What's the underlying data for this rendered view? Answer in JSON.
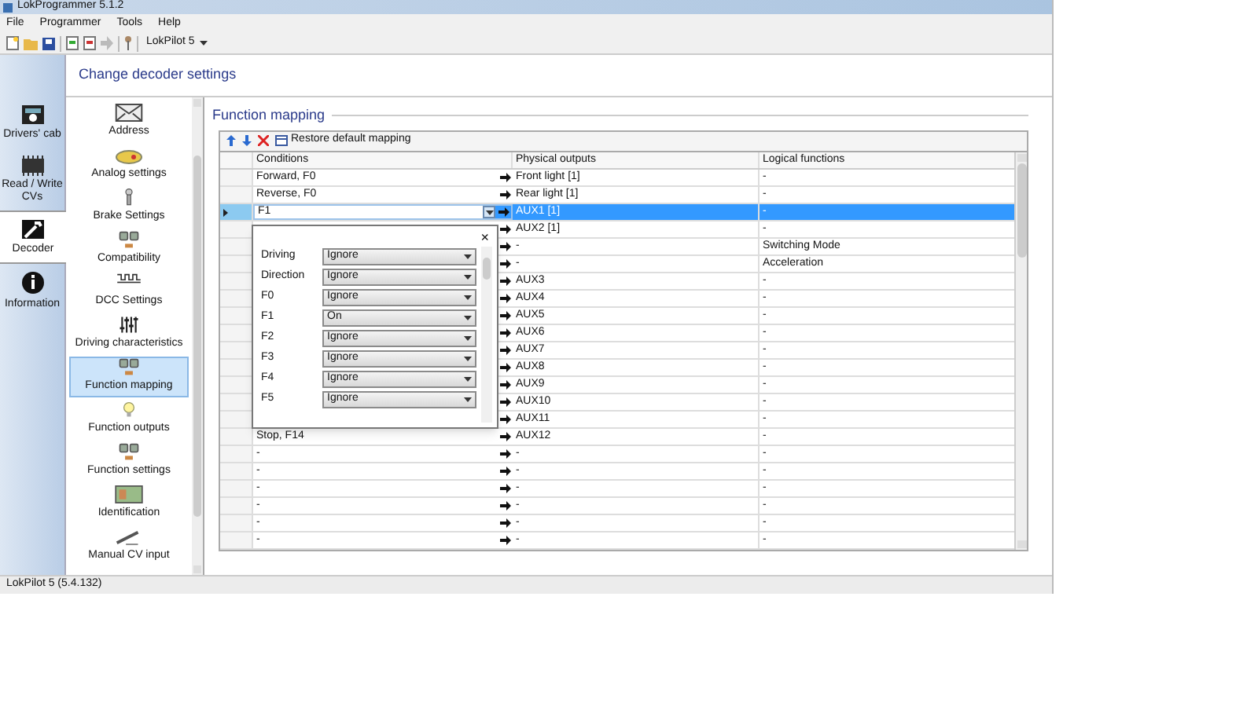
{
  "window": {
    "title": "LokProgrammer 5.1.2"
  },
  "menu": [
    "File",
    "Programmer",
    "Tools",
    "Help"
  ],
  "toolbar": {
    "device": "LokPilot 5"
  },
  "side_tabs": [
    {
      "label": "Drivers' cab",
      "selected": false
    },
    {
      "label": "Read / Write CVs",
      "selected": false
    },
    {
      "label": "Decoder",
      "selected": true
    },
    {
      "label": "Information",
      "selected": false
    }
  ],
  "page_title": "Change decoder settings",
  "categories": [
    {
      "label": "Address",
      "selected": false
    },
    {
      "label": "Analog settings",
      "selected": false
    },
    {
      "label": "Brake Settings",
      "selected": false
    },
    {
      "label": "Compatibility",
      "selected": false
    },
    {
      "label": "DCC Settings",
      "selected": false
    },
    {
      "label": "Driving characteristics",
      "selected": false
    },
    {
      "label": "Function mapping",
      "selected": true
    },
    {
      "label": "Function outputs",
      "selected": false
    },
    {
      "label": "Function settings",
      "selected": false
    },
    {
      "label": "Identification",
      "selected": false
    },
    {
      "label": "Manual CV input",
      "selected": false
    }
  ],
  "section_title": "Function mapping",
  "table_toolbar": {
    "restore_button": "Restore default mapping"
  },
  "table": {
    "columns": [
      "Conditions",
      "Physical outputs",
      "Logical functions"
    ],
    "rows": [
      {
        "condition": "Forward, F0",
        "output": "Front light [1]",
        "logic": "-",
        "selected": false
      },
      {
        "condition": "Reverse, F0",
        "output": "Rear light [1]",
        "logic": "-",
        "selected": false
      },
      {
        "condition": "F1",
        "output": "AUX1 [1]",
        "logic": "-",
        "selected": true
      },
      {
        "output": "AUX2 [1]",
        "logic": "-",
        "selected": false
      },
      {
        "output": "-",
        "logic": "Switching Mode",
        "selected": false
      },
      {
        "output": "-",
        "logic": "Acceleration",
        "selected": false
      },
      {
        "output": "AUX3",
        "logic": "-",
        "selected": false
      },
      {
        "output": "AUX4",
        "logic": "-",
        "selected": false
      },
      {
        "output": "AUX5",
        "logic": "-",
        "selected": false
      },
      {
        "output": "AUX6",
        "logic": "-",
        "selected": false
      },
      {
        "output": "AUX7",
        "logic": "-",
        "selected": false
      },
      {
        "output": "AUX8",
        "logic": "-",
        "selected": false
      },
      {
        "output": "AUX9",
        "logic": "-",
        "selected": false
      },
      {
        "output": "AUX10",
        "logic": "-",
        "selected": false
      },
      {
        "output": "AUX11",
        "logic": "-",
        "selected": false
      },
      {
        "condition": "Stop, F14",
        "output": "AUX12",
        "logic": "-",
        "selected": false
      },
      {
        "condition": "-",
        "output": "-",
        "logic": "-",
        "selected": false
      },
      {
        "condition": "-",
        "output": "-",
        "logic": "-",
        "selected": false
      },
      {
        "condition": "-",
        "output": "-",
        "logic": "-",
        "selected": false
      },
      {
        "condition": "-",
        "output": "-",
        "logic": "-",
        "selected": false
      },
      {
        "condition": "-",
        "output": "-",
        "logic": "-",
        "selected": false
      },
      {
        "condition": "-",
        "output": "-",
        "logic": "-",
        "selected": false
      }
    ]
  },
  "condition_popup": {
    "close": "×",
    "fields": [
      {
        "label": "Driving",
        "value": "Ignore"
      },
      {
        "label": "Direction",
        "value": "Ignore"
      },
      {
        "label": "F0",
        "value": "Ignore"
      },
      {
        "label": "F1",
        "value": "On"
      },
      {
        "label": "F2",
        "value": "Ignore"
      },
      {
        "label": "F3",
        "value": "Ignore"
      },
      {
        "label": "F4",
        "value": "Ignore"
      },
      {
        "label": "F5",
        "value": "Ignore"
      }
    ]
  },
  "status_bar": "LokPilot 5 (5.4.132)"
}
